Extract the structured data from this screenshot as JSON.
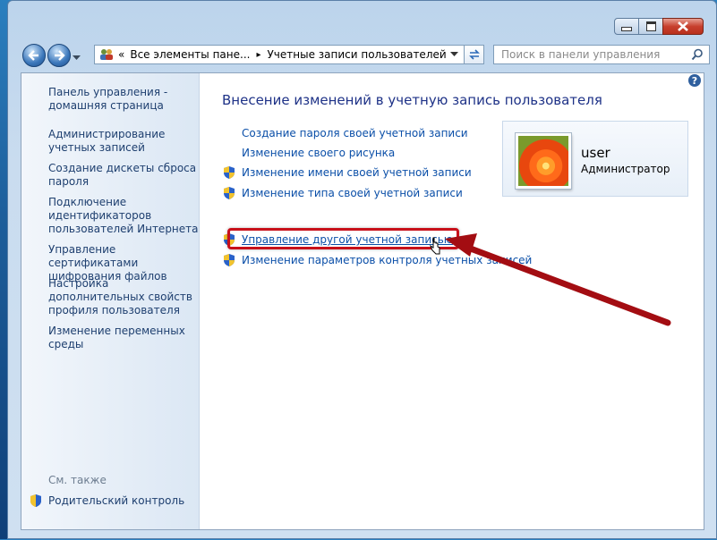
{
  "window": {
    "caption_buttons": [
      "minimize-icon",
      "maximize-icon",
      "close-icon"
    ]
  },
  "nav": {
    "back_icon": "back-arrow-icon",
    "forward_icon": "forward-arrow-icon",
    "breadcrumb_prefix": "«",
    "breadcrumb": [
      "Все элементы пане...",
      "Учетные записи пользователей"
    ],
    "separator": "▸",
    "search_placeholder": "Поиск в панели управления"
  },
  "sidebar": {
    "items": [
      {
        "label": "Панель управления - домашняя страница"
      },
      {
        "label": "Администрирование учетных записей"
      },
      {
        "label": "Создание дискеты сброса пароля"
      },
      {
        "label": "Подключение идентификаторов пользователей Интернета"
      },
      {
        "label": "Управление сертификатами шифрования файлов"
      },
      {
        "label": "Настройка дополнительных свойств профиля пользователя"
      },
      {
        "label": "Изменение переменных среды"
      }
    ],
    "see_also": "См. также",
    "parental_control": "Родительский контроль"
  },
  "main": {
    "title": "Внесение изменений в учетную запись пользователя",
    "tasks": [
      {
        "label": "Создание пароля своей учетной записи",
        "shield": false
      },
      {
        "label": "Изменение своего рисунка",
        "shield": false
      },
      {
        "label": "Изменение имени своей учетной записи",
        "shield": true
      },
      {
        "label": "Изменение типа своей учетной записи",
        "shield": true
      }
    ],
    "tasks2": [
      {
        "label": "Управление другой учетной записью",
        "shield": true
      },
      {
        "label": "Изменение параметров контроля учетных записей",
        "shield": true
      }
    ]
  },
  "user": {
    "name": "user",
    "role": "Администратор"
  },
  "colors": {
    "link": "#0b4fa8",
    "title": "#1e3287",
    "highlight": "#c8101a"
  }
}
